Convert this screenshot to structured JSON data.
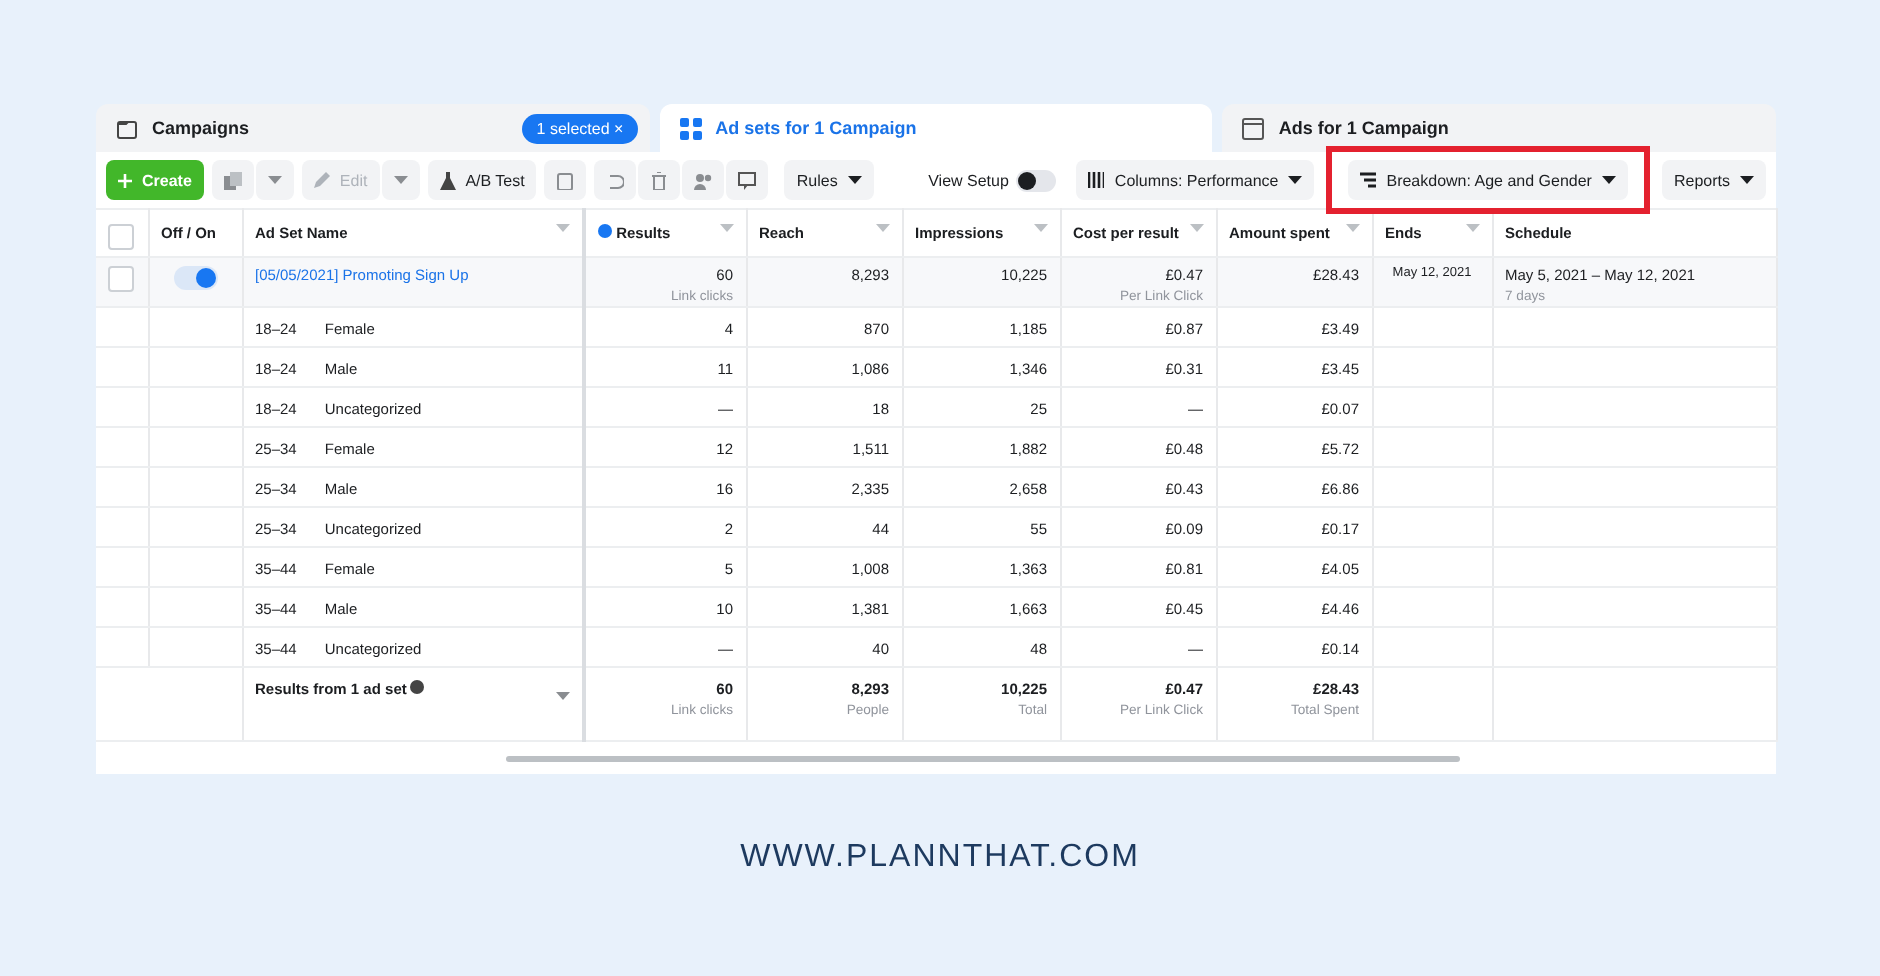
{
  "tabs": [
    {
      "kind": "campaigns",
      "label": "Campaigns",
      "selected": false,
      "badge": "1 selected",
      "badge_close": "×"
    },
    {
      "kind": "adsets",
      "label": "Ad sets for 1 Campaign",
      "selected": true
    },
    {
      "kind": "ads",
      "label": "Ads for 1 Campaign",
      "selected": false
    }
  ],
  "toolbar": {
    "create": "Create",
    "edit": {
      "label": "Edit",
      "disabled": true
    },
    "ab_test": "A/B Test",
    "rules": "Rules",
    "view_setup": {
      "label": "View Setup",
      "on": false
    },
    "columns": "Columns: Performance",
    "breakdown": {
      "label": "Breakdown: Age and Gender",
      "highlighted": true
    },
    "reports": "Reports"
  },
  "table": {
    "all_checked": false,
    "columns": [
      {
        "label": "Off / On",
        "sortable": false
      },
      {
        "label": "Ad Set Name",
        "sortable": true
      },
      {
        "label": "Results",
        "sortable": true,
        "info": true
      },
      {
        "label": "Reach",
        "sortable": true
      },
      {
        "label": "Impressions",
        "sortable": true
      },
      {
        "label": "Cost per result",
        "sortable": true
      },
      {
        "label": "Amount spent",
        "sortable": true
      },
      {
        "label": "Ends",
        "sortable": true
      },
      {
        "label": "Schedule",
        "sortable": false
      }
    ],
    "ad_set": {
      "checked": false,
      "on": true,
      "name": "[05/05/2021] Promoting Sign Up",
      "results": "60",
      "results_note": "Link clicks",
      "reach": "8,293",
      "impressions": "10,225",
      "cost": "£0.47",
      "cost_note": "Per Link Click",
      "amount": "£28.43",
      "ends": "May 12, 2021",
      "schedule": "May 5, 2021 – May 12, 2021",
      "schedule_note": "7 days"
    },
    "rows": [
      {
        "age": "18–24",
        "gender": "Female",
        "results": "4",
        "reach": "870",
        "impressions": "1,185",
        "cost": "£0.87",
        "amount": "£3.49"
      },
      {
        "age": "18–24",
        "gender": "Male",
        "results": "11",
        "reach": "1,086",
        "impressions": "1,346",
        "cost": "£0.31",
        "amount": "£3.45"
      },
      {
        "age": "18–24",
        "gender": "Uncategorized",
        "results": "—",
        "reach": "18",
        "impressions": "25",
        "cost": "—",
        "amount": "£0.07"
      },
      {
        "age": "25–34",
        "gender": "Female",
        "results": "12",
        "reach": "1,511",
        "impressions": "1,882",
        "cost": "£0.48",
        "amount": "£5.72"
      },
      {
        "age": "25–34",
        "gender": "Male",
        "results": "16",
        "reach": "2,335",
        "impressions": "2,658",
        "cost": "£0.43",
        "amount": "£6.86"
      },
      {
        "age": "25–34",
        "gender": "Uncategorized",
        "results": "2",
        "reach": "44",
        "impressions": "55",
        "cost": "£0.09",
        "amount": "£0.17"
      },
      {
        "age": "35–44",
        "gender": "Female",
        "results": "5",
        "reach": "1,008",
        "impressions": "1,363",
        "cost": "£0.81",
        "amount": "£4.05"
      },
      {
        "age": "35–44",
        "gender": "Male",
        "results": "10",
        "reach": "1,381",
        "impressions": "1,663",
        "cost": "£0.45",
        "amount": "£4.46"
      },
      {
        "age": "35–44",
        "gender": "Uncategorized",
        "results": "—",
        "reach": "40",
        "impressions": "48",
        "cost": "—",
        "amount": "£0.14"
      }
    ],
    "totals": {
      "label": "Results from 1 ad set",
      "results": "60",
      "results_note": "Link clicks",
      "reach": "8,293",
      "reach_note": "People",
      "impressions": "10,225",
      "impressions_note": "Total",
      "cost": "£0.47",
      "cost_note": "Per Link Click",
      "amount": "£28.43",
      "amount_note": "Total Spent"
    }
  },
  "footer": "WWW.PLANNTHAT.COM"
}
